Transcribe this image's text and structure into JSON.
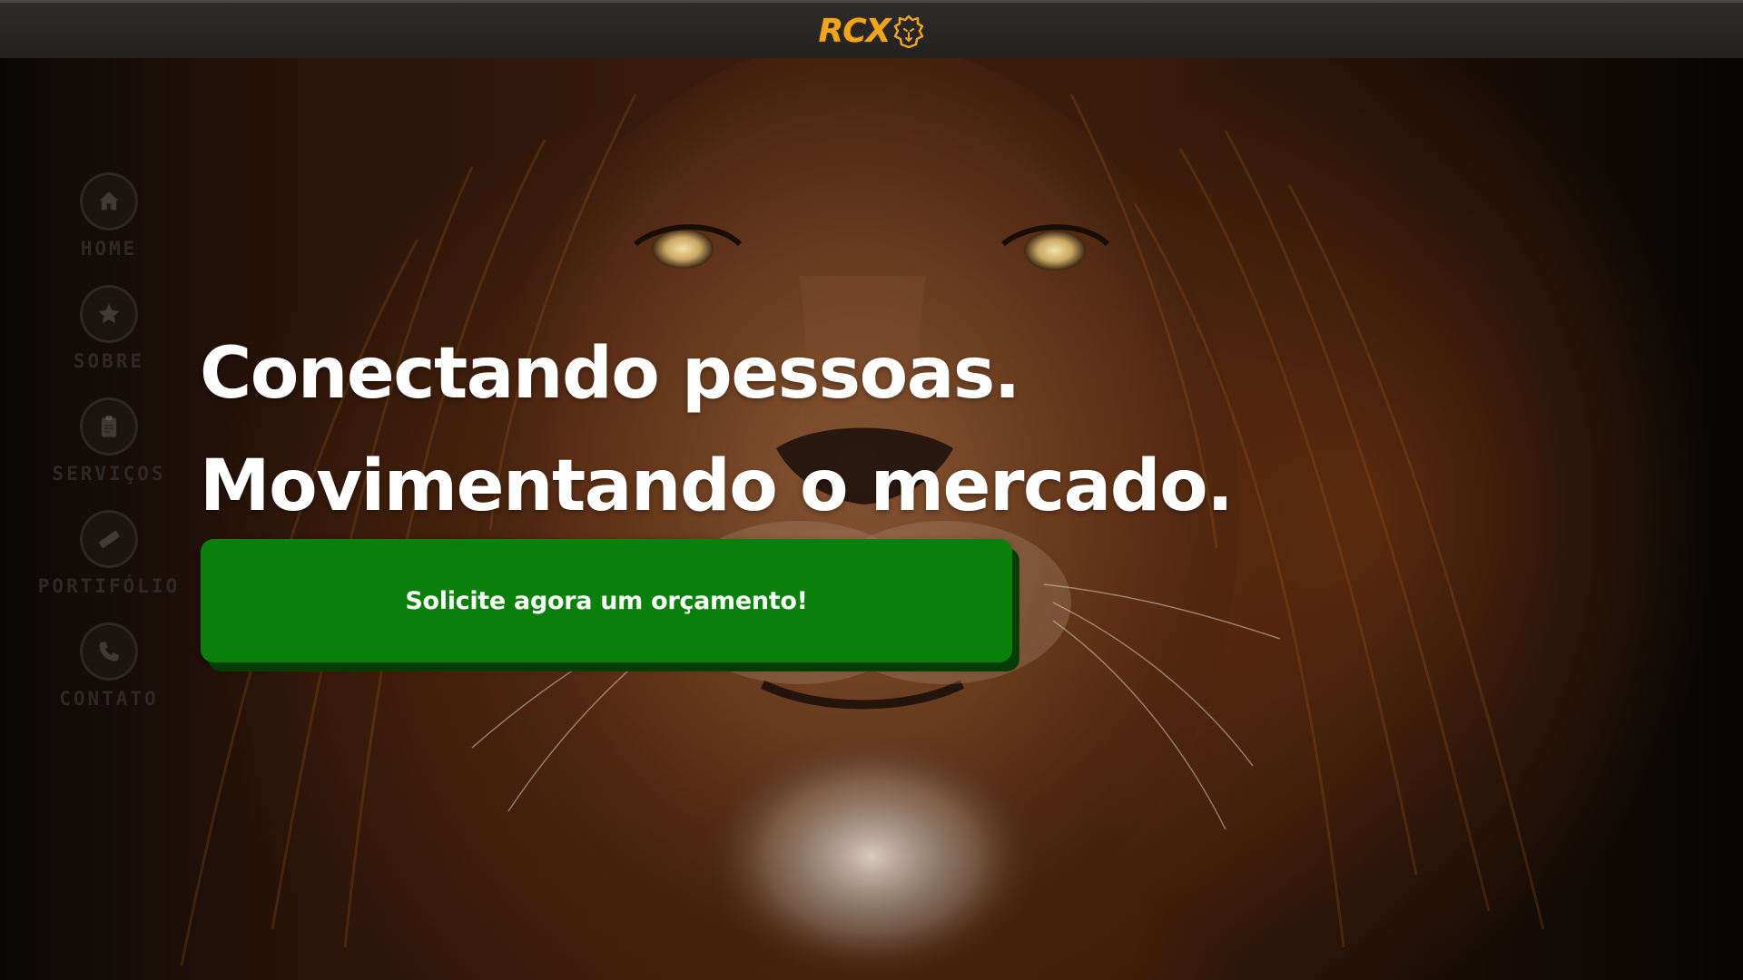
{
  "header": {
    "logo_text": "RCX",
    "logo_icon": "lion-head-icon",
    "accent_color": "#f2a51c"
  },
  "side_nav": {
    "items": [
      {
        "label": "HOME",
        "icon": "home-icon"
      },
      {
        "label": "SOBRE",
        "icon": "star-icon"
      },
      {
        "label": "SERVIÇOS",
        "icon": "clipboard-icon"
      },
      {
        "label": "PORTIFÓLIO",
        "icon": "ruler-icon"
      },
      {
        "label": "CONTATO",
        "icon": "phone-icon"
      }
    ]
  },
  "hero": {
    "background": "lion-photo",
    "headline_line1": "Conectando pessoas.",
    "headline_line2": "Movimentando o mercado.",
    "cta_label": "Solicite agora um orçamento!",
    "cta_color": "#0a7f0a"
  }
}
